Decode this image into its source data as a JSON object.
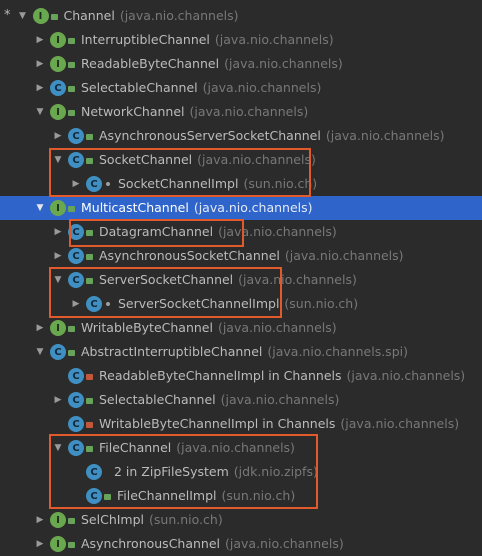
{
  "rows": [
    {
      "name": "Channel",
      "pkg": "(java.nio.channels)",
      "icon": "I",
      "lock": "green",
      "arrow": "down",
      "star": "*"
    },
    {
      "name": "InterruptibleChannel",
      "pkg": "(java.nio.channels)",
      "icon": "I",
      "lock": "green",
      "arrow": "right"
    },
    {
      "name": "ReadableByteChannel",
      "pkg": "(java.nio.channels)",
      "icon": "I",
      "lock": "green",
      "arrow": "right"
    },
    {
      "name": "SelectableChannel",
      "pkg": "(java.nio.channels)",
      "icon": "C",
      "lock": "green",
      "arrow": "right"
    },
    {
      "name": "NetworkChannel",
      "pkg": "(java.nio.channels)",
      "icon": "I",
      "lock": "green",
      "arrow": "down"
    },
    {
      "name": "AsynchronousServerSocketChannel",
      "pkg": "(java.nio.channels)",
      "icon": "C",
      "lock": "green",
      "arrow": "right"
    },
    {
      "name": "SocketChannel",
      "pkg": "(java.nio.channels)",
      "icon": "C",
      "lock": "green",
      "arrow": "down"
    },
    {
      "name": "SocketChannelImpl",
      "pkg": "(sun.nio.ch)",
      "icon": "C",
      "lock": "dot",
      "arrow": "right"
    },
    {
      "name": "MulticastChannel",
      "pkg": "(java.nio.channels)",
      "icon": "I",
      "lock": "green",
      "arrow": "down"
    },
    {
      "name": "DatagramChannel",
      "pkg": "(java.nio.channels)",
      "icon": "C",
      "lock": "green",
      "arrow": "right"
    },
    {
      "name": "AsynchronousSocketChannel",
      "pkg": "(java.nio.channels)",
      "icon": "C",
      "lock": "green",
      "arrow": "right"
    },
    {
      "name": "ServerSocketChannel",
      "pkg": "(java.nio.channels)",
      "icon": "C",
      "lock": "green",
      "arrow": "down"
    },
    {
      "name": "ServerSocketChannelImpl",
      "pkg": "(sun.nio.ch)",
      "icon": "C",
      "lock": "dot",
      "arrow": "right"
    },
    {
      "name": "WritableByteChannel",
      "pkg": "(java.nio.channels)",
      "icon": "I",
      "lock": "green",
      "arrow": "right"
    },
    {
      "name": "AbstractInterruptibleChannel",
      "pkg": "(java.nio.channels.spi)",
      "icon": "C",
      "lock": "green",
      "arrow": "down"
    },
    {
      "name": "ReadableByteChannelImpl in Channels",
      "pkg": "(java.nio.channels)",
      "icon": "C",
      "lock": "red",
      "arrow": "none"
    },
    {
      "name": "SelectableChannel",
      "pkg": "(java.nio.channels)",
      "icon": "C",
      "lock": "green",
      "arrow": "right"
    },
    {
      "name": "WritableByteChannelImpl in Channels",
      "pkg": "(java.nio.channels)",
      "icon": "C",
      "lock": "red",
      "arrow": "none"
    },
    {
      "name": "FileChannel",
      "pkg": "(java.nio.channels)",
      "icon": "C",
      "lock": "green",
      "arrow": "down"
    },
    {
      "name": "2 in ZipFileSystem",
      "pkg": "(jdk.nio.zipfs)",
      "icon": "C",
      "lock": "none",
      "arrow": "none"
    },
    {
      "name": "FileChannelImpl",
      "pkg": "(sun.nio.ch)",
      "icon": "C",
      "lock": "green",
      "arrow": "none"
    },
    {
      "name": "SelChImpl",
      "pkg": "(sun.nio.ch)",
      "icon": "I",
      "lock": "green",
      "arrow": "right"
    },
    {
      "name": "AsynchronousChannel",
      "pkg": "(java.nio.channels)",
      "icon": "I",
      "lock": "green",
      "arrow": "right"
    }
  ],
  "selected_index": 8,
  "colors": {
    "highlight_box": "#e05a2b",
    "selection": "#2f65ca",
    "background": "#2b2b2b"
  }
}
